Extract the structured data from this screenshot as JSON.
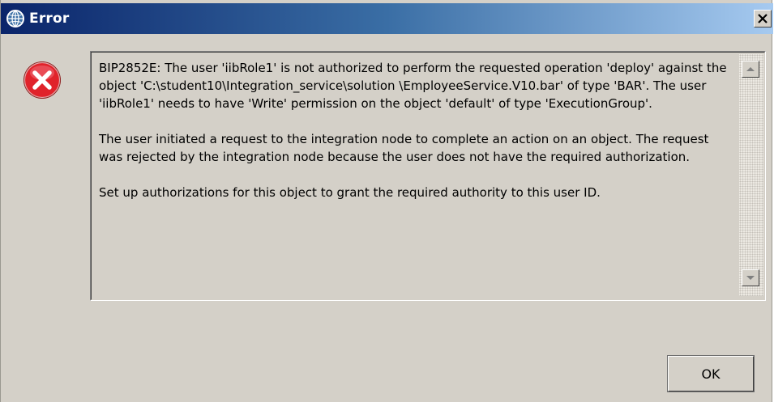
{
  "window": {
    "title": "Error",
    "title_icon": "globe-icon",
    "close_label": "close-icon"
  },
  "message": {
    "icon": "error-x-icon",
    "paragraphs": [
      "BIP2852E: The user 'iibRole1' is not authorized to perform the requested operation 'deploy' against the object 'C:\\student10\\Integration_service\\solution \\EmployeeService.V10.bar' of type 'BAR'. The user 'iibRole1' needs to have 'Write' permission on the object 'default' of type 'ExecutionGroup'.",
      "The user initiated a request to the integration node to complete an action on an object. The request was rejected by the integration node because the user does not have the required authorization.",
      "Set up authorizations for this object to grant the required authority to this user ID."
    ]
  },
  "buttons": {
    "ok_label": "OK"
  },
  "colors": {
    "dialog_bg": "#d4d0c8",
    "titlebar_start": "#0a246a",
    "titlebar_end": "#a6caf0",
    "error_red": "#e0232b"
  }
}
